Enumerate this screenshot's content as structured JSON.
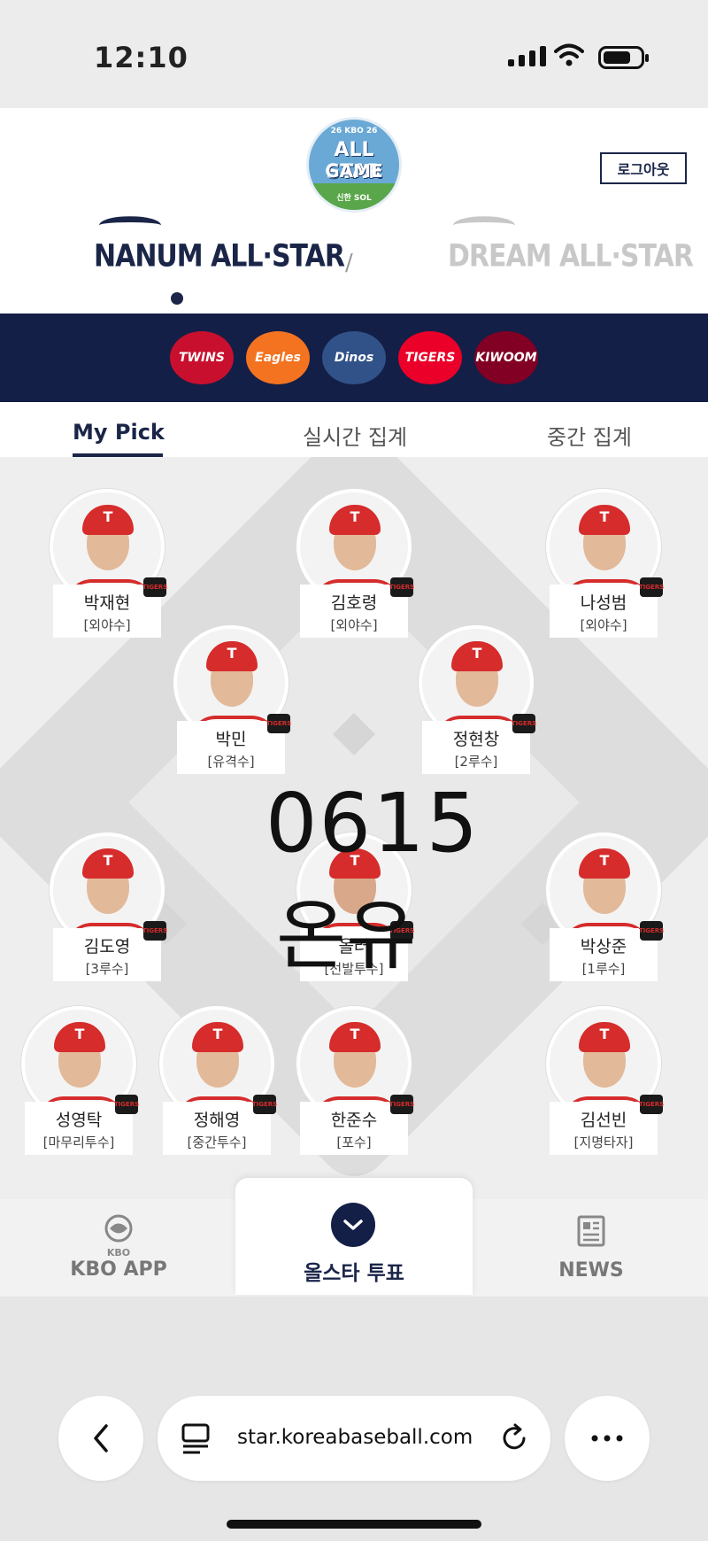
{
  "status": {
    "time": "12:10"
  },
  "header": {
    "logo": {
      "top": "26 KBO 26",
      "line1": "ALL STAR",
      "line2": "GAME",
      "sponsor": "신한 SOL"
    },
    "logout_label": "로그아웃",
    "brands": {
      "nanum": "NANUM ALL·STAR",
      "dream": "DREAM ALL·STAR",
      "separator": "/"
    }
  },
  "teams": [
    {
      "name": "TWINS",
      "color": "#c8102e"
    },
    {
      "name": "Eagles",
      "color": "#f37321"
    },
    {
      "name": "Dinos",
      "color": "#315288"
    },
    {
      "name": "TIGERS",
      "color": "#ea0029"
    },
    {
      "name": "KIWOOM",
      "color": "#820024"
    }
  ],
  "tabs": {
    "my_pick": "My Pick",
    "live": "실시간 집계",
    "mid": "중간 집계"
  },
  "players": [
    {
      "name": "박재현",
      "pos": "[외야수]",
      "cap": "T",
      "team": "TIGERS"
    },
    {
      "name": "김호령",
      "pos": "[외야수]",
      "cap": "T",
      "team": "TIGERS"
    },
    {
      "name": "나성범",
      "pos": "[외야수]",
      "cap": "T",
      "team": "TIGERS"
    },
    {
      "name": "박민",
      "pos": "[유격수]",
      "cap": "T",
      "team": "TIGERS"
    },
    {
      "name": "정현창",
      "pos": "[2루수]",
      "cap": "T",
      "team": "TIGERS"
    },
    {
      "name": "김도영",
      "pos": "[3루수]",
      "cap": "T",
      "team": "TIGERS"
    },
    {
      "name": "올러",
      "pos": "[선발투수]",
      "cap": "T",
      "team": "TIGERS"
    },
    {
      "name": "박상준",
      "pos": "[1루수]",
      "cap": "T",
      "team": "TIGERS"
    },
    {
      "name": "성영탁",
      "pos": "[마무리투수]",
      "cap": "T",
      "team": "TIGERS"
    },
    {
      "name": "정해영",
      "pos": "[중간투수]",
      "cap": "T",
      "team": "TIGERS"
    },
    {
      "name": "한준수",
      "pos": "[포수]",
      "cap": "T",
      "team": "TIGERS"
    },
    {
      "name": "김선빈",
      "pos": "[지명타자]",
      "cap": "T",
      "team": "TIGERS"
    }
  ],
  "overlay": {
    "number": "0615",
    "text": "온유"
  },
  "nav": {
    "kbo_logo": "KBO",
    "kbo_app": "KBO APP",
    "vote": "올스타 투표",
    "news": "NEWS"
  },
  "browser": {
    "url": "star.koreabaseball.com"
  },
  "colors": {
    "navy": "#131f47",
    "tigers_red": "#d62c2c"
  }
}
